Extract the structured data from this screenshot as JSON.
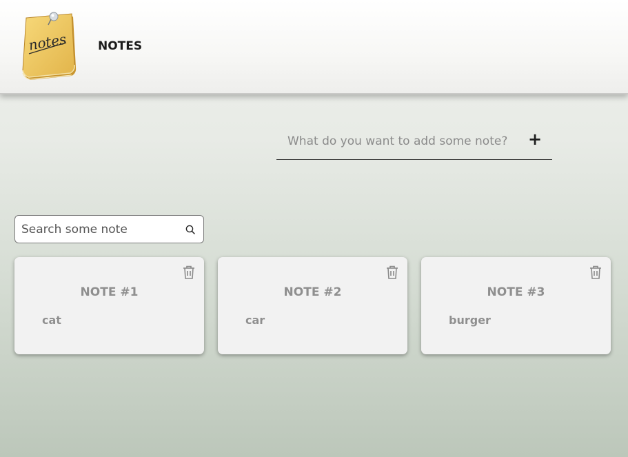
{
  "header": {
    "title": "NOTES",
    "logo_text": "notes",
    "logo_icon": "sticky-notes-icon"
  },
  "add_note": {
    "placeholder": "What do you want to add some note?",
    "value": "",
    "add_label": "+"
  },
  "search": {
    "placeholder": "Search some note",
    "value": "",
    "icon": "search-icon"
  },
  "notes": [
    {
      "title": "NOTE #1",
      "text": "cat",
      "delete_icon": "trash-icon"
    },
    {
      "title": "NOTE #2",
      "text": "car",
      "delete_icon": "trash-icon"
    },
    {
      "title": "NOTE #3",
      "text": "burger",
      "delete_icon": "trash-icon"
    }
  ],
  "colors": {
    "card_background": "#f2f2f2",
    "card_text": "#8f8f8f",
    "header_text": "#1b1b1b"
  }
}
